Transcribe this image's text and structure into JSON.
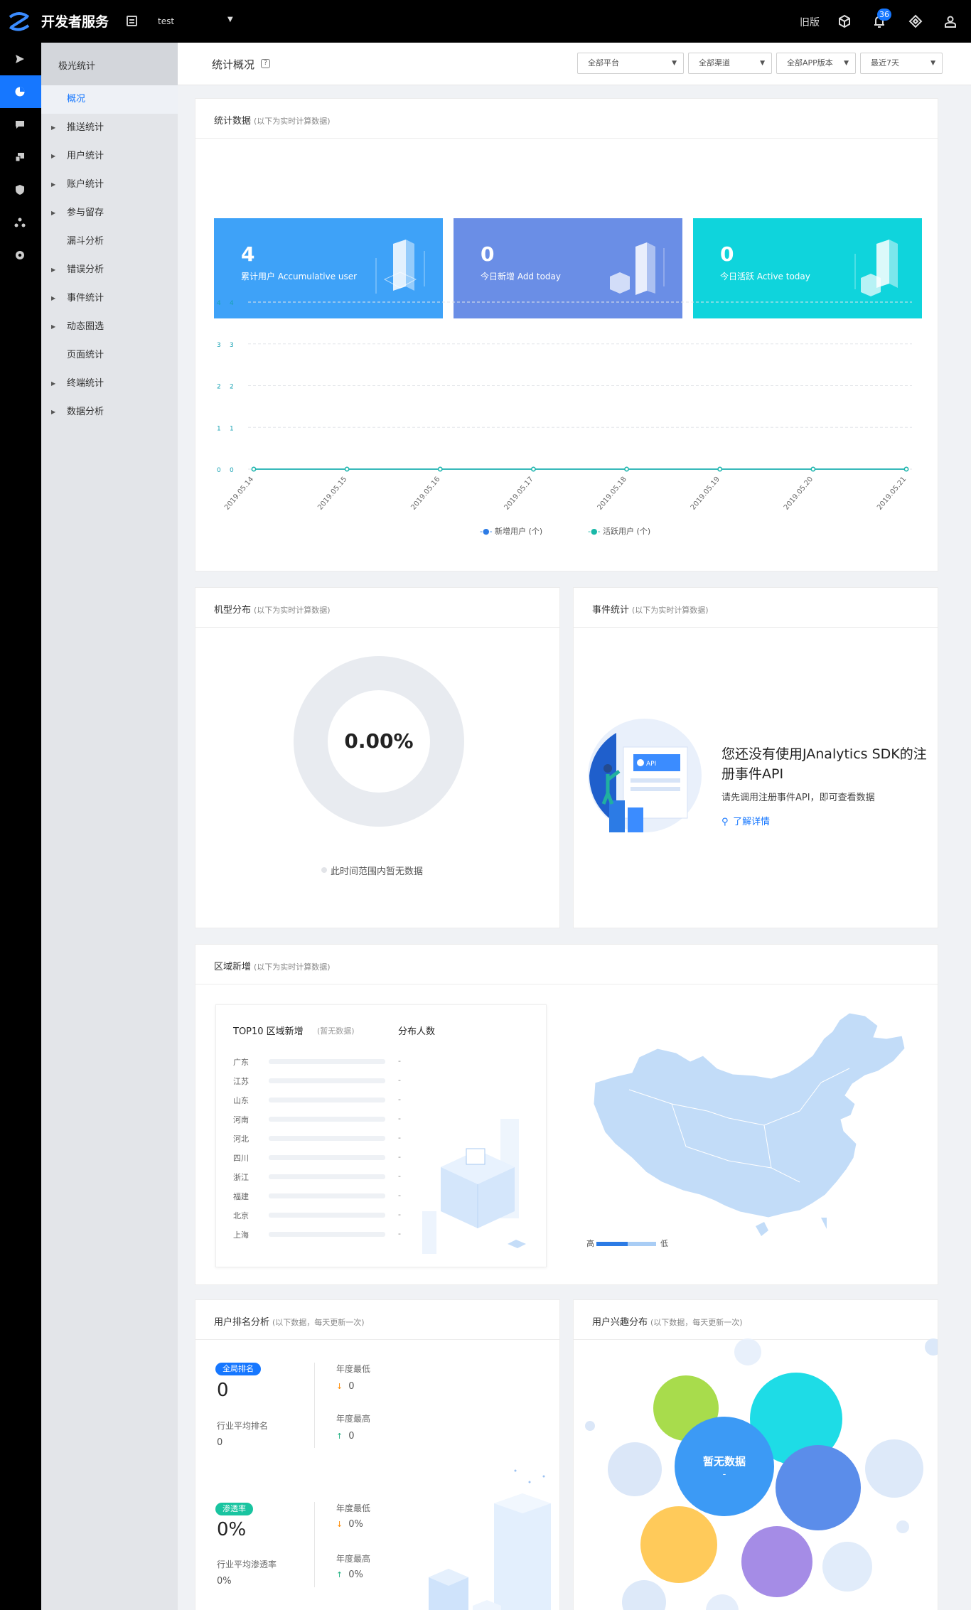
{
  "topbar": {
    "brand": "开发者服务",
    "app_name": "test",
    "old_version": "旧版",
    "notification_count": "36"
  },
  "iconrail": {
    "icons": [
      "push-icon",
      "statistics-icon",
      "message-icon",
      "devices-icon",
      "shield-icon",
      "organization-icon",
      "settings-icon"
    ],
    "active_index": 1
  },
  "sidebar": {
    "title": "极光统计",
    "items": [
      {
        "label": "概况",
        "expandable": false,
        "active": true
      },
      {
        "label": "推送统计",
        "expandable": true
      },
      {
        "label": "用户统计",
        "expandable": true
      },
      {
        "label": "账户统计",
        "expandable": true
      },
      {
        "label": "参与留存",
        "expandable": true
      },
      {
        "label": "漏斗分析",
        "expandable": false
      },
      {
        "label": "错误分析",
        "expandable": true
      },
      {
        "label": "事件统计",
        "expandable": true
      },
      {
        "label": "动态圈选",
        "expandable": true
      },
      {
        "label": "页面统计",
        "expandable": false
      },
      {
        "label": "终端统计",
        "expandable": true
      },
      {
        "label": "数据分析",
        "expandable": true
      }
    ]
  },
  "subheader": {
    "title": "统计概况",
    "help": "?",
    "filters": [
      "全部平台",
      "全部渠道",
      "全部APP版本",
      "最近7天"
    ]
  },
  "stats_card": {
    "title": "统计数据",
    "note": "(以下为实时计算数据)",
    "tiles": [
      {
        "value": "4",
        "label": "累计用户 Accumulative user",
        "color": "#3ea2f8"
      },
      {
        "value": "0",
        "label": "今日新增 Add today",
        "color": "#6a8ee6"
      },
      {
        "value": "0",
        "label": "今日活跃 Active today",
        "color": "#0fd4dc"
      }
    ]
  },
  "chart_data": {
    "type": "line",
    "x": [
      "2019.05.14",
      "2019.05.15",
      "2019.05.16",
      "2019.05.17",
      "2019.05.18",
      "2019.05.19",
      "2019.05.20",
      "2019.05.21"
    ],
    "ylim": [
      0,
      4
    ],
    "yticks": [
      "0",
      "1",
      "2",
      "3",
      "4"
    ],
    "series": [
      {
        "name": "新增用户 (个)",
        "values": [
          0,
          0,
          0,
          0,
          0,
          0,
          0,
          0
        ],
        "color": "#2c7be5"
      },
      {
        "name": "活跃用户 (个)",
        "values": [
          0,
          0,
          0,
          0,
          0,
          0,
          0,
          0
        ],
        "color": "#19b8a8"
      }
    ],
    "grid": true,
    "legend": "bottom-center"
  },
  "model_card": {
    "title": "机型分布",
    "note": "(以下为实时计算数据)",
    "percent": "0.00%",
    "empty": "此时间范围内暂无数据"
  },
  "event_card": {
    "title": "事件统计",
    "note": "(以下为实时计算数据)",
    "message": "您还没有使用JAnalytics SDK的注册事件API",
    "hint": "请先调用注册事件API，即可查看数据",
    "link": "了解详情",
    "api_badge": "API"
  },
  "region_card": {
    "title": "区域新增",
    "note": "(以下为实时计算数据)",
    "top10_title": "TOP10 区域新增",
    "top10_note": "(暂无数据)",
    "col_header": "分布人数",
    "rows": [
      {
        "city": "广东",
        "value": "-"
      },
      {
        "city": "江苏",
        "value": "-"
      },
      {
        "city": "山东",
        "value": "-"
      },
      {
        "city": "河南",
        "value": "-"
      },
      {
        "city": "河北",
        "value": "-"
      },
      {
        "city": "四川",
        "value": "-"
      },
      {
        "city": "浙江",
        "value": "-"
      },
      {
        "city": "福建",
        "value": "-"
      },
      {
        "city": "北京",
        "value": "-"
      },
      {
        "city": "上海",
        "value": "-"
      }
    ],
    "legend_high": "高",
    "legend_low": "低"
  },
  "rank_card": {
    "title": "用户排名分析",
    "note": "(以下数据，每天更新一次)",
    "global_tag": "全局排名",
    "global_value": "0",
    "industry_avg_rank_label": "行业平均排名",
    "industry_avg_rank": "0",
    "year_low_label": "年度最低",
    "year_low_rank": "0",
    "year_high_label": "年度最高",
    "year_high_rank": "0",
    "penetration_tag": "渗透率",
    "penetration_value": "0%",
    "industry_avg_pen_label": "行业平均渗透率",
    "industry_avg_pen": "0%",
    "year_low_pen": "0%",
    "year_high_pen": "0%"
  },
  "interest_card": {
    "title": "用户兴趣分布",
    "note": "(以下数据，每天更新一次)",
    "empty": "暂无数据",
    "empty_sub": "-"
  }
}
